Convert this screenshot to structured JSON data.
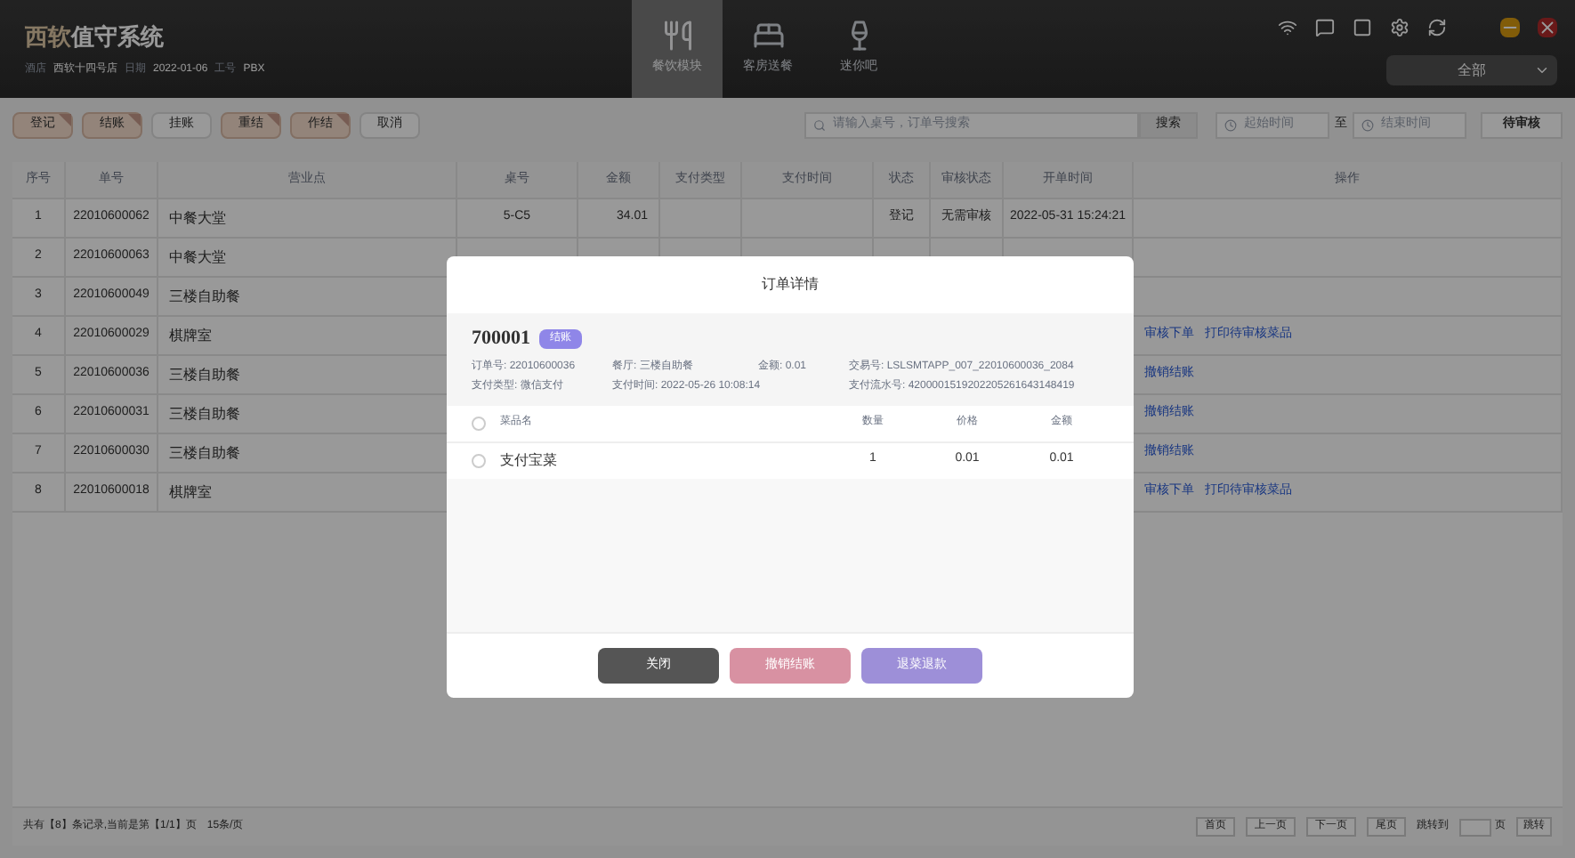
{
  "header": {
    "brand_prefix": "西软",
    "brand": "值守系统",
    "info": [
      {
        "label": "酒店",
        "value": "西软十四号店"
      },
      {
        "label": "日期",
        "value": "2022-01-06"
      },
      {
        "label": "工号",
        "value": "PBX"
      }
    ]
  },
  "nav": [
    {
      "label": "餐饮模块",
      "kind": "dining",
      "selected": true
    },
    {
      "label": "客房送餐",
      "kind": "bed",
      "selected": false
    },
    {
      "label": "迷你吧",
      "kind": "bar",
      "selected": false
    }
  ],
  "filter_select": {
    "value": "全部"
  },
  "toolbar": [
    {
      "label": "登记",
      "selected": true
    },
    {
      "label": "结账",
      "selected": true
    },
    {
      "label": "挂账",
      "selected": false
    },
    {
      "label": "重结",
      "selected": true
    },
    {
      "label": "作结",
      "selected": true
    },
    {
      "label": "取消",
      "selected": false
    }
  ],
  "search": {
    "placeholder": "请输入桌号，订单号搜索",
    "button": "搜索",
    "start_placeholder": "起始时间",
    "to": "至",
    "end_placeholder": "结束时间",
    "pending_button": "待审核"
  },
  "table": {
    "columns": [
      "序号",
      "单号",
      "营业点",
      "桌号",
      "金额",
      "支付类型",
      "支付时间",
      "状态",
      "审核状态",
      "开单时间",
      "操作"
    ],
    "rows": [
      {
        "cells": [
          "1",
          "22010600062",
          "中餐大堂",
          "5-C5",
          "34.01",
          "",
          "",
          "登记",
          "无需审核",
          "2022-05-31 15:24:21"
        ],
        "actions": []
      },
      {
        "cells": [
          "2",
          "22010600063",
          "中餐大堂"
        ],
        "actions": []
      },
      {
        "cells": [
          "3",
          "22010600049",
          "三楼自助餐"
        ],
        "actions": []
      },
      {
        "cells": [
          "4",
          "22010600029",
          "棋牌室"
        ],
        "actions": [
          "审核下单",
          "打印待审核菜品"
        ]
      },
      {
        "cells": [
          "5",
          "22010600036",
          "三楼自助餐"
        ],
        "actions": [
          "撤销结账"
        ]
      },
      {
        "cells": [
          "6",
          "22010600031",
          "三楼自助餐"
        ],
        "actions": [
          "撤销结账"
        ]
      },
      {
        "cells": [
          "7",
          "22010600030",
          "三楼自助餐"
        ],
        "actions": [
          "撤销结账"
        ]
      },
      {
        "cells": [
          "8",
          "22010600018",
          "棋牌室"
        ],
        "actions": [
          "审核下单",
          "打印待审核菜品"
        ]
      }
    ]
  },
  "footer": {
    "summary": "共有【8】条记录,当前是第【1/1】页",
    "page_size": "15条/页",
    "buttons": [
      "首页",
      "上一页",
      "下一页",
      "尾页"
    ],
    "jump_label": "跳转到",
    "page_unit": "页",
    "jump_button": "跳转"
  },
  "dialog": {
    "title": "订单详情",
    "table_no": "700001",
    "status": "结账",
    "fields": [
      [
        "订单号: 22010600036",
        "支付类型: 微信支付"
      ],
      [
        "餐厅: 三楼自助餐",
        "支付时间: 2022-05-26 10:08:14"
      ],
      [
        "金额: 0.01"
      ],
      [
        "交易号: LSLSMTAPP_007_22010600036_2084",
        "支付流水号: 4200001519202205261643148419"
      ]
    ],
    "columns": [
      "菜品名",
      "数量",
      "价格",
      "金额"
    ],
    "select_all_checked": false,
    "items": [
      {
        "name": "支付宝菜",
        "qty": "1",
        "price": "0.01",
        "amount": "0.01",
        "checked": false
      }
    ],
    "buttons": [
      {
        "label": "关闭",
        "kind": "close"
      },
      {
        "label": "撤销结账",
        "kind": "cancel"
      },
      {
        "label": "退菜退款",
        "kind": "refund"
      }
    ]
  }
}
